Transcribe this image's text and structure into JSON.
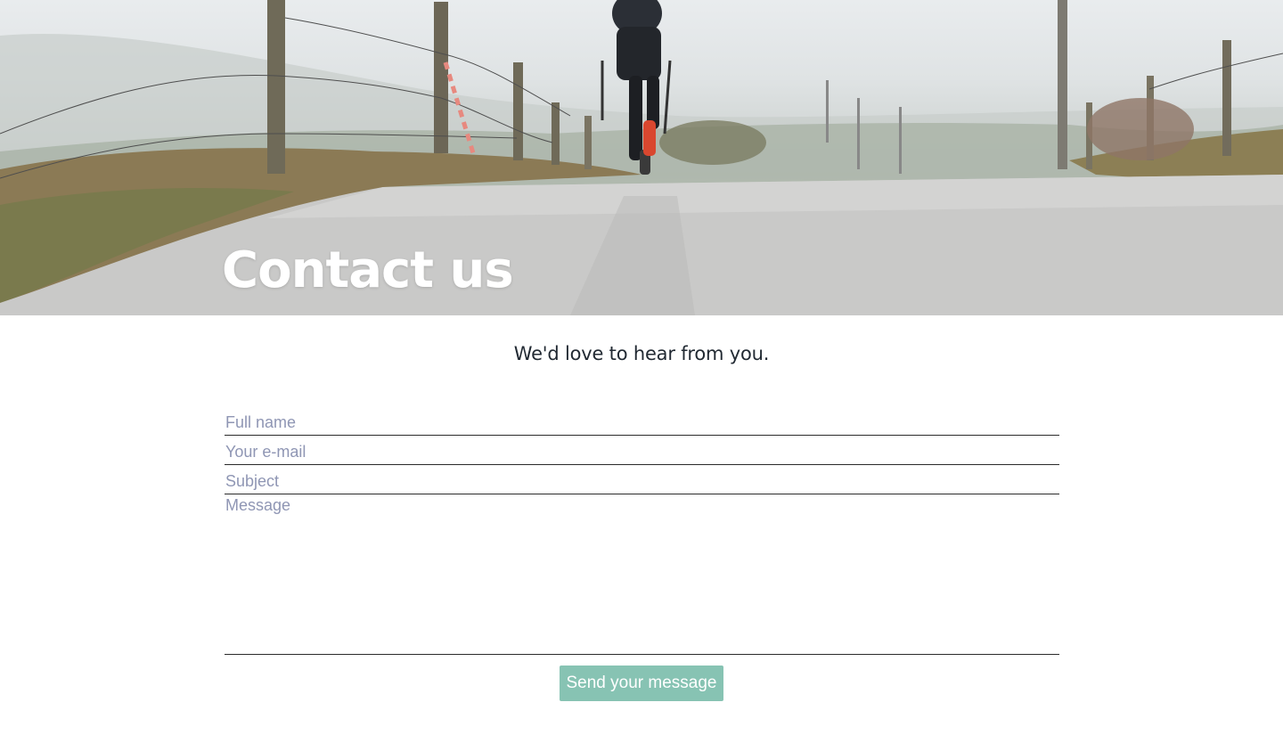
{
  "hero": {
    "title": "Contact us",
    "image_alt": "runner-on-wet-country-road"
  },
  "intro": {
    "text": "We'd love to hear from you."
  },
  "form": {
    "full_name_placeholder": "Full name",
    "email_placeholder": "Your e-mail",
    "subject_placeholder": "Subject",
    "message_placeholder": "Message",
    "submit_label": "Send your message"
  },
  "colors": {
    "accent": "#87c3b3",
    "placeholder": "#8f96b4",
    "text": "#222a33"
  }
}
